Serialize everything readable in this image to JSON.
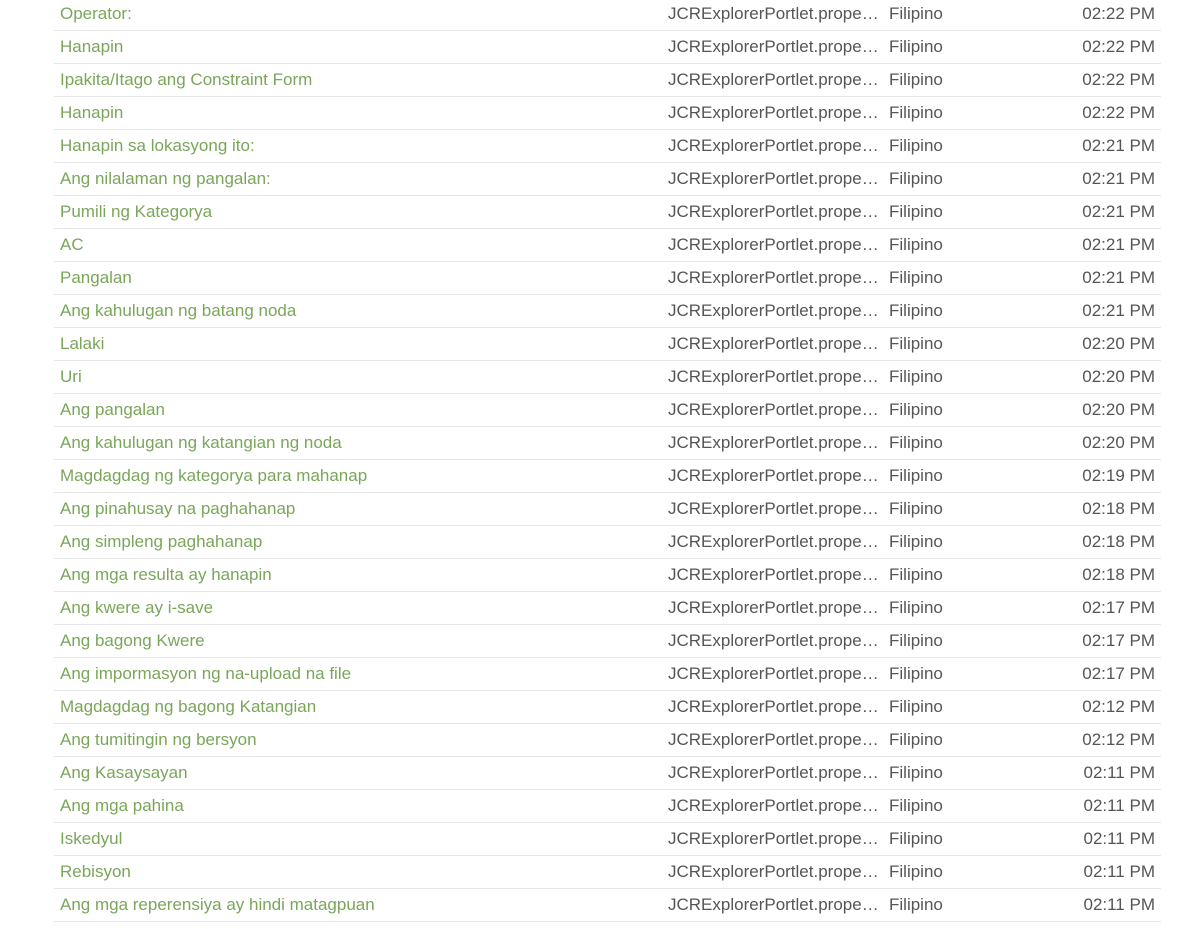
{
  "colors": {
    "link": "#7aa65a",
    "text": "#555555",
    "divider": "#e6e6e6"
  },
  "rows": [
    {
      "text": "Operator:",
      "file": "JCRExplorerPortlet.properties",
      "language": "Filipino",
      "time": "02:22 PM"
    },
    {
      "text": "Hanapin",
      "file": "JCRExplorerPortlet.properties",
      "language": "Filipino",
      "time": "02:22 PM"
    },
    {
      "text": "Ipakita/Itago ang Constraint Form",
      "file": "JCRExplorerPortlet.properties",
      "language": "Filipino",
      "time": "02:22 PM"
    },
    {
      "text": "Hanapin",
      "file": "JCRExplorerPortlet.properties",
      "language": "Filipino",
      "time": "02:22 PM"
    },
    {
      "text": "Hanapin sa lokasyong ito:",
      "file": "JCRExplorerPortlet.properties",
      "language": "Filipino",
      "time": "02:21 PM"
    },
    {
      "text": "Ang nilalaman ng pangalan:",
      "file": "JCRExplorerPortlet.properties",
      "language": "Filipino",
      "time": "02:21 PM"
    },
    {
      "text": "Pumili ng Kategorya",
      "file": "JCRExplorerPortlet.properties",
      "language": "Filipino",
      "time": "02:21 PM"
    },
    {
      "text": "AC",
      "file": "JCRExplorerPortlet.properties",
      "language": "Filipino",
      "time": "02:21 PM"
    },
    {
      "text": "Pangalan",
      "file": "JCRExplorerPortlet.properties",
      "language": "Filipino",
      "time": "02:21 PM"
    },
    {
      "text": "Ang kahulugan ng batang noda",
      "file": "JCRExplorerPortlet.properties",
      "language": "Filipino",
      "time": "02:21 PM"
    },
    {
      "text": "Lalaki",
      "file": "JCRExplorerPortlet.properties",
      "language": "Filipino",
      "time": "02:20 PM"
    },
    {
      "text": "Uri",
      "file": "JCRExplorerPortlet.properties",
      "language": "Filipino",
      "time": "02:20 PM"
    },
    {
      "text": "Ang pangalan",
      "file": "JCRExplorerPortlet.properties",
      "language": "Filipino",
      "time": "02:20 PM"
    },
    {
      "text": "Ang kahulugan ng katangian ng noda",
      "file": "JCRExplorerPortlet.properties",
      "language": "Filipino",
      "time": "02:20 PM"
    },
    {
      "text": "Magdagdag ng kategorya para mahanap",
      "file": "JCRExplorerPortlet.properties",
      "language": "Filipino",
      "time": "02:19 PM"
    },
    {
      "text": "Ang pinahusay na paghahanap",
      "file": "JCRExplorerPortlet.properties",
      "language": "Filipino",
      "time": "02:18 PM"
    },
    {
      "text": "Ang simpleng paghahanap",
      "file": "JCRExplorerPortlet.properties",
      "language": "Filipino",
      "time": "02:18 PM"
    },
    {
      "text": "Ang mga resulta ay hanapin",
      "file": "JCRExplorerPortlet.properties",
      "language": "Filipino",
      "time": "02:18 PM"
    },
    {
      "text": "Ang kwere ay i-save",
      "file": "JCRExplorerPortlet.properties",
      "language": "Filipino",
      "time": "02:17 PM"
    },
    {
      "text": "Ang bagong Kwere",
      "file": "JCRExplorerPortlet.properties",
      "language": "Filipino",
      "time": "02:17 PM"
    },
    {
      "text": "Ang impormasyon ng na-upload na file",
      "file": "JCRExplorerPortlet.properties",
      "language": "Filipino",
      "time": "02:17 PM"
    },
    {
      "text": "Magdagdag ng bagong Katangian",
      "file": "JCRExplorerPortlet.properties",
      "language": "Filipino",
      "time": "02:12 PM"
    },
    {
      "text": "Ang tumitingin ng bersyon",
      "file": "JCRExplorerPortlet.properties",
      "language": "Filipino",
      "time": "02:12 PM"
    },
    {
      "text": "Ang Kasaysayan",
      "file": "JCRExplorerPortlet.properties",
      "language": "Filipino",
      "time": "02:11 PM"
    },
    {
      "text": "Ang mga pahina",
      "file": "JCRExplorerPortlet.properties",
      "language": "Filipino",
      "time": "02:11 PM"
    },
    {
      "text": "Iskedyul",
      "file": "JCRExplorerPortlet.properties",
      "language": "Filipino",
      "time": "02:11 PM"
    },
    {
      "text": "Rebisyon",
      "file": "JCRExplorerPortlet.properties",
      "language": "Filipino",
      "time": "02:11 PM"
    },
    {
      "text": "Ang mga reperensiya ay hindi matagpuan",
      "file": "JCRExplorerPortlet.properties",
      "language": "Filipino",
      "time": "02:11 PM"
    }
  ]
}
